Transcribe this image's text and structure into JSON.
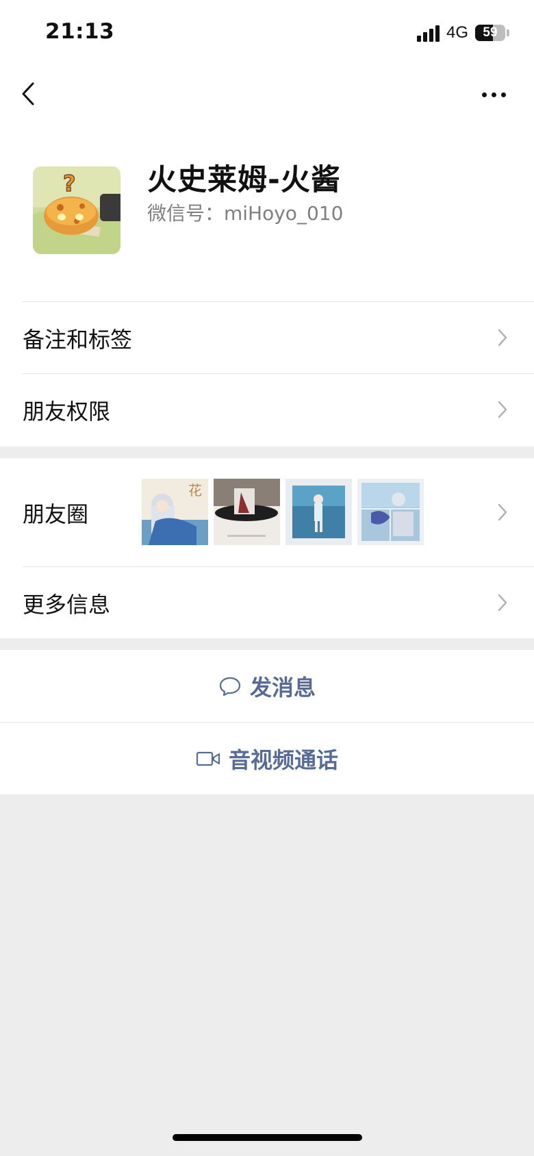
{
  "status_bar": {
    "time": "21:13",
    "network": "4G",
    "battery": "59",
    "battery_level": 0.59
  },
  "nav": {
    "back_icon": "chevron-left-icon",
    "more_icon": "ellipsis-icon"
  },
  "profile": {
    "nickname": "火史莱姆-火酱",
    "wechat_id": "微信号：miHoyo_010"
  },
  "menu": {
    "remark_tags": "备注和标签",
    "friend_permissions": "朋友权限",
    "moments": "朋友圈",
    "more_info": "更多信息"
  },
  "actions": {
    "send_message": "发消息",
    "video_call": "音视频通话"
  },
  "colors": {
    "link": "#576b95",
    "background": "#ededed",
    "card": "#ffffff"
  }
}
